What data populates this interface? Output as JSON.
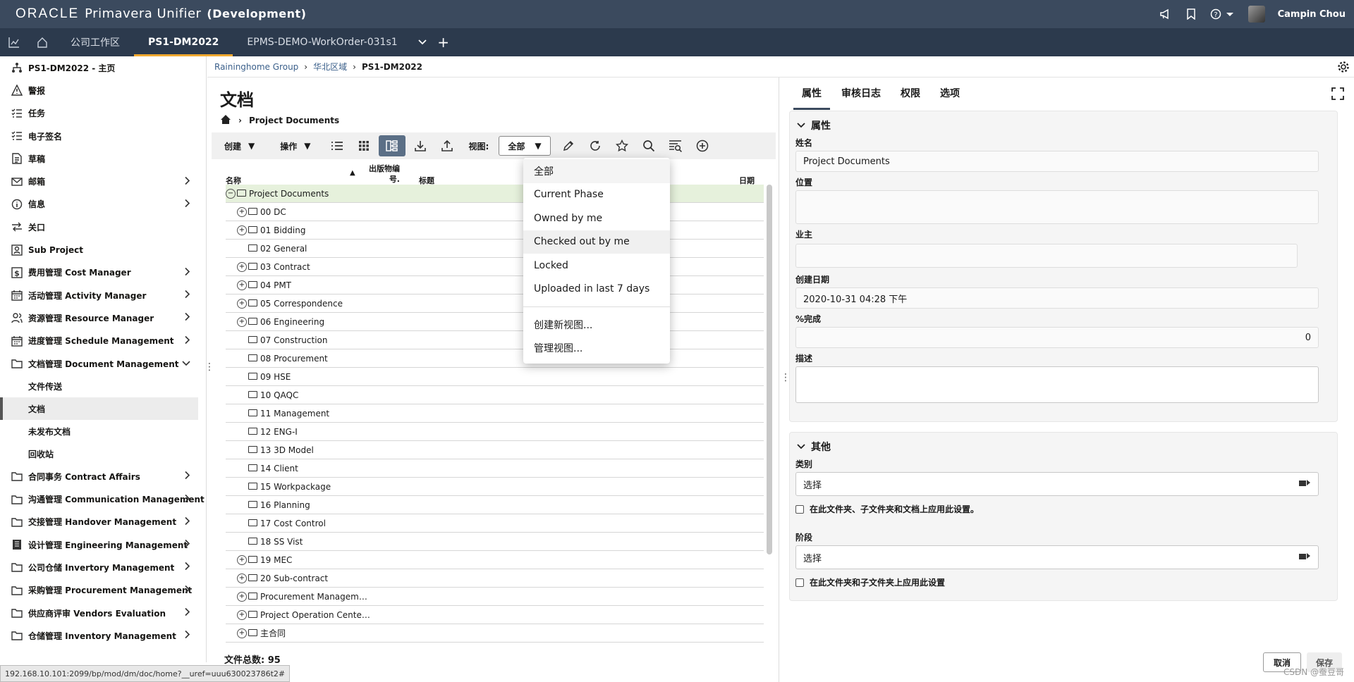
{
  "header": {
    "brand_oracle": "ORACLE",
    "brand_app": "Primavera Unifier",
    "brand_env": "(Development)",
    "user_name": "Campin Chou"
  },
  "tabs": [
    {
      "label": "公司工作区"
    },
    {
      "label": "PS1-DM2022"
    },
    {
      "label": "EPMS-DEMO-WorkOrder-031s1"
    }
  ],
  "sidebar": {
    "top_items": [
      {
        "label": "PS1-DM2022 - 主页",
        "icon": "hierarchy-icon"
      },
      {
        "label": "警报",
        "icon": "alert-icon"
      },
      {
        "label": "任务",
        "icon": "tasks-icon"
      },
      {
        "label": "电子签名",
        "icon": "esign-icon"
      },
      {
        "label": "草稿",
        "icon": "drafts-icon"
      },
      {
        "label": "邮箱",
        "icon": "mail-icon"
      },
      {
        "label": "信息",
        "icon": "info-icon"
      },
      {
        "label": "关口",
        "icon": "gates-icon"
      },
      {
        "label": "Sub Project",
        "icon": "subproject-icon"
      },
      {
        "label": "费用管理 Cost Manager",
        "icon": "dollar-icon"
      },
      {
        "label": "活动管理 Activity Manager",
        "icon": "calendar-icon"
      },
      {
        "label": "资源管理 Resource Manager",
        "icon": "people-icon"
      },
      {
        "label": "进度管理 Schedule Management",
        "icon": "calendar-icon"
      },
      {
        "label": "文档管理 Document Management",
        "icon": "folder-icon"
      }
    ],
    "sub_items": [
      {
        "label": "文件传送"
      },
      {
        "label": "文档"
      },
      {
        "label": "未发布文档"
      },
      {
        "label": "回收站"
      }
    ],
    "bottom_items": [
      {
        "label": "合同事务 Contract Affairs",
        "icon": "folder-icon"
      },
      {
        "label": "沟通管理 Communication Management",
        "icon": "folder-icon"
      },
      {
        "label": "交接管理 Handover Management",
        "icon": "folder-icon"
      },
      {
        "label": "设计管理 Engineering Management",
        "icon": "book-icon"
      },
      {
        "label": "公司仓储 Invertory Management",
        "icon": "folder-icon"
      },
      {
        "label": "采购管理 Procurement Management",
        "icon": "folder-icon"
      },
      {
        "label": "供应商评审 Vendors Evaluation",
        "icon": "folder-icon"
      },
      {
        "label": "仓储管理 Inventory Management",
        "icon": "folder-icon"
      }
    ]
  },
  "breadcrumb": {
    "group": "Raininghome Group",
    "region": "华北区域",
    "current": "PS1-DM2022"
  },
  "doc": {
    "title": "文档",
    "path": "Project Documents",
    "toolbar": {
      "create": "创建",
      "actions": "操作",
      "view_label": "视图:",
      "view_value": "全部"
    },
    "columns": {
      "name": "名称",
      "pub_no": "出版物编号.",
      "title": "标题",
      "date": "日期"
    },
    "root": "Project Documents",
    "rows": [
      {
        "name": "00 DC",
        "expandable": true
      },
      {
        "name": "01 Bidding",
        "expandable": true
      },
      {
        "name": "02 General",
        "expandable": false
      },
      {
        "name": "03 Contract",
        "expandable": true
      },
      {
        "name": "04 PMT",
        "expandable": true
      },
      {
        "name": "05 Correspondence",
        "expandable": true
      },
      {
        "name": "06 Engineering",
        "expandable": true
      },
      {
        "name": "07 Construction",
        "expandable": false
      },
      {
        "name": "08 Procurement",
        "expandable": false
      },
      {
        "name": "09 HSE",
        "expandable": false
      },
      {
        "name": "10 QAQC",
        "expandable": false
      },
      {
        "name": "11 Management",
        "expandable": false
      },
      {
        "name": "12 ENG-I",
        "expandable": false
      },
      {
        "name": "13 3D Model",
        "expandable": false
      },
      {
        "name": "14 Client",
        "expandable": false
      },
      {
        "name": "15 Workpackage",
        "expandable": false
      },
      {
        "name": "16 Planning",
        "expandable": false
      },
      {
        "name": "17 Cost Control",
        "expandable": false
      },
      {
        "name": "18 SS Vist",
        "expandable": false
      },
      {
        "name": "19 MEC",
        "expandable": true
      },
      {
        "name": "20 Sub-contract",
        "expandable": true
      },
      {
        "name": "Procurement Managem…",
        "expandable": true
      },
      {
        "name": "Project Operation Cente…",
        "expandable": true
      },
      {
        "name": "主合同",
        "expandable": true
      }
    ],
    "count_label": "文件总数: 95"
  },
  "view_menu": {
    "items": [
      "全部",
      "Current Phase",
      "Owned by me",
      "Checked out by me",
      "Locked",
      "Uploaded in last 7 days"
    ],
    "actions": [
      "创建新视图...",
      "管理视图..."
    ]
  },
  "status_url": "192.168.10.101:2099/bp/mod/dm/doc/home?__uref=uuu630023786t2#",
  "right": {
    "tabs": [
      "属性",
      "审核日志",
      "权限",
      "选项"
    ],
    "props_section": "属性",
    "name_label": "姓名",
    "name_value": "Project Documents",
    "location_label": "位置",
    "owner_label": "业主",
    "created_label": "创建日期",
    "created_value": "2020-10-31 04:28 下午",
    "percent_label": "%完成",
    "percent_value": "0",
    "desc_label": "描述",
    "other_section": "其他",
    "category_label": "类别",
    "category_value": "选择",
    "category_apply": "在此文件夹、子文件夹和文档上应用此设置。",
    "phase_label": "阶段",
    "phase_value": "选择",
    "phase_apply": "在此文件夹和子文件夹上应用此设置",
    "cancel": "取消",
    "save": "保存",
    "watermark": "CSDN @蚕豆哥"
  },
  "colors": {
    "header_bg": "#3b4a5e",
    "tabbar_bg": "#2c3a4d",
    "active_tab_accent": "#f0a830",
    "root_row_bg": "#e6f1dc"
  }
}
